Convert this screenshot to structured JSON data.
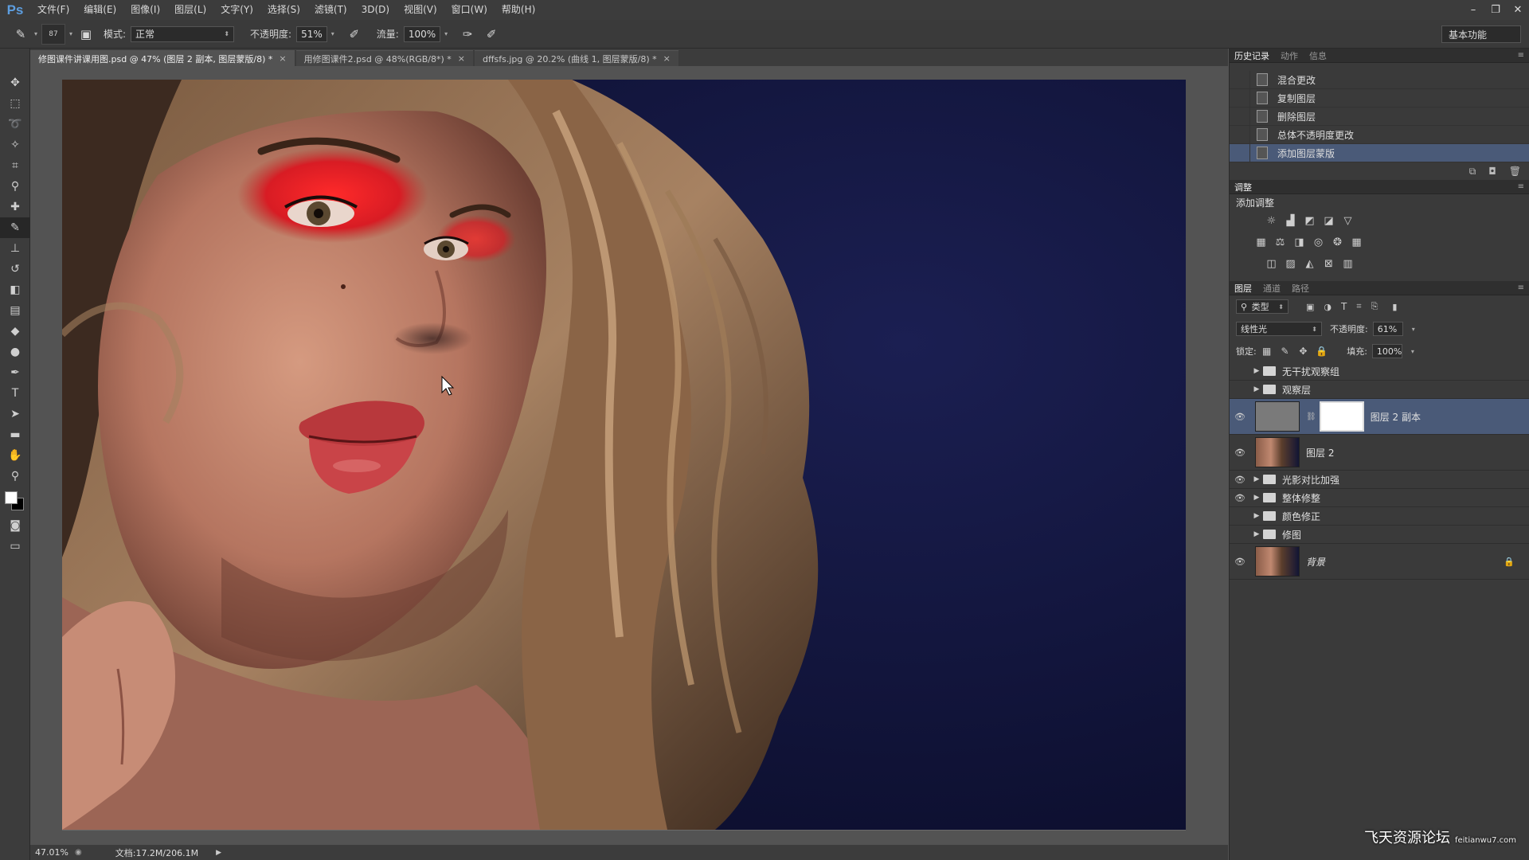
{
  "app": {
    "logo": "Ps"
  },
  "menu": [
    "文件(F)",
    "编辑(E)",
    "图像(I)",
    "图层(L)",
    "文字(Y)",
    "选择(S)",
    "滤镜(T)",
    "3D(D)",
    "视图(V)",
    "窗口(W)",
    "帮助(H)"
  ],
  "window_controls": [
    "–",
    "❐",
    "✕"
  ],
  "options": {
    "brush_size": "87",
    "mode_label": "模式:",
    "mode_value": "正常",
    "opacity_label": "不透明度:",
    "opacity_value": "51%",
    "flow_label": "流量:",
    "flow_value": "100%",
    "workspace": "基本功能"
  },
  "doc_tabs": [
    {
      "label": "修图课件讲课用图.psd @ 47% (图层 2 副本, 图层蒙版/8) *",
      "close": "×"
    },
    {
      "label": "用修图课件2.psd @ 48%(RGB/8*) *",
      "close": "×"
    },
    {
      "label": "dffsfs.jpg @ 20.2% (曲线 1, 图层蒙版/8) *",
      "close": "×"
    }
  ],
  "status": {
    "zoom": "47.01%",
    "doc_size": "文档:17.2M/206.1M"
  },
  "history": {
    "tabs": [
      "历史记录",
      "动作",
      "信息"
    ],
    "items": [
      {
        "label": "混合更改",
        "selected": false
      },
      {
        "label": "复制图层",
        "selected": false
      },
      {
        "label": "删除图层",
        "selected": false
      },
      {
        "label": "总体不透明度更改",
        "selected": false
      },
      {
        "label": "添加图层蒙版",
        "selected": true
      }
    ]
  },
  "adjustments": {
    "tab": "调整",
    "title": "添加调整",
    "row1_icons": [
      "brightness-icon",
      "levels-icon",
      "curves-icon",
      "exposure-icon",
      "vibrance-icon"
    ],
    "row2_icons": [
      "hue-saturation-icon",
      "color-balance-icon",
      "black-white-icon",
      "photo-filter-icon",
      "channel-mixer-icon",
      "color-lookup-icon"
    ],
    "row3_icons": [
      "invert-icon",
      "posterize-icon",
      "threshold-icon",
      "selective-color-icon",
      "gradient-map-icon"
    ]
  },
  "layers": {
    "tabs": [
      "图层",
      "通道",
      "路径"
    ],
    "filter": "类型",
    "blend_mode": "线性光",
    "opacity_label": "不透明度:",
    "opacity_value": "61%",
    "lock_label": "锁定:",
    "fill_label": "填充:",
    "fill_value": "100%",
    "items": [
      {
        "name": "无干扰观察组",
        "type": "group",
        "visible": false
      },
      {
        "name": "观察层",
        "type": "group",
        "visible": false
      },
      {
        "name": "图层 2 副本",
        "type": "masked",
        "visible": true,
        "selected": true
      },
      {
        "name": "图层 2",
        "type": "pixel",
        "visible": true
      },
      {
        "name": "光影对比加强",
        "type": "group",
        "visible": true
      },
      {
        "name": "整体修整",
        "type": "group",
        "visible": true
      },
      {
        "name": "颜色修正",
        "type": "group",
        "visible": false
      },
      {
        "name": "修图",
        "type": "group",
        "visible": false
      },
      {
        "name": "背景",
        "type": "background",
        "visible": true,
        "locked": true
      }
    ]
  },
  "watermark": {
    "text": "飞天资源论坛",
    "url": "feitianwu7.com"
  }
}
